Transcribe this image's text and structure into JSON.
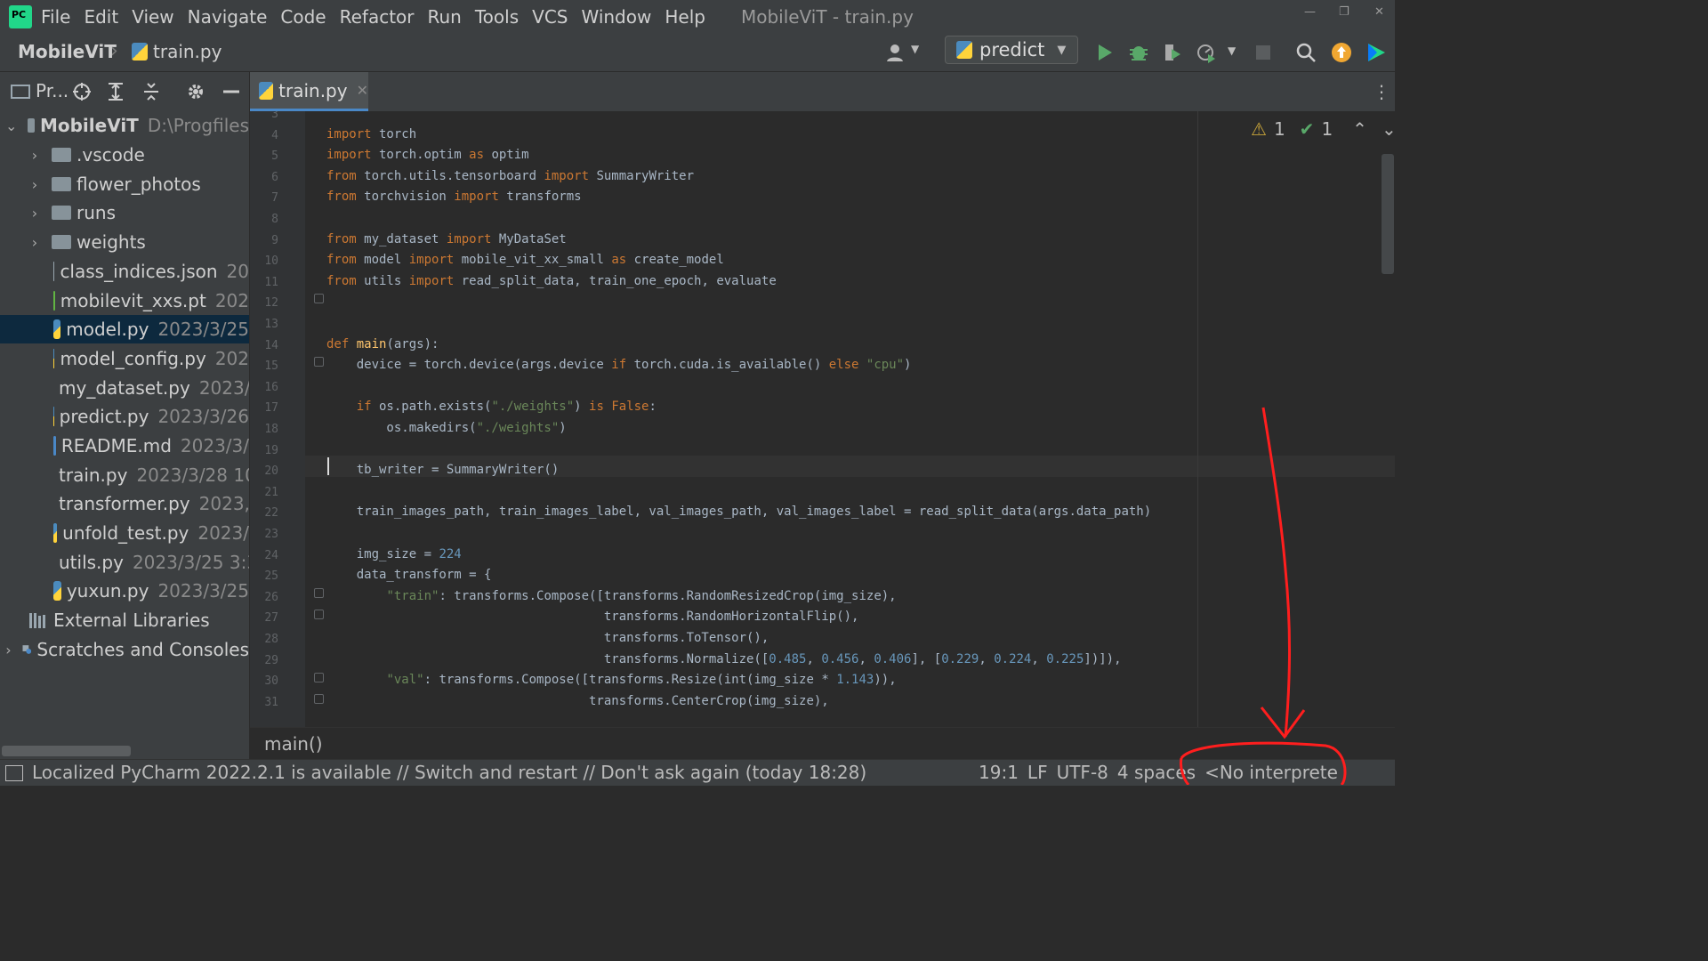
{
  "menubar": {
    "items": [
      "File",
      "Edit",
      "View",
      "Navigate",
      "Code",
      "Refactor",
      "Run",
      "Tools",
      "VCS",
      "Window",
      "Help"
    ],
    "window_title": "MobileViT - train.py"
  },
  "navbar": {
    "project": "MobileViT",
    "file": "train.py",
    "run_config": "predict"
  },
  "project_toolbar": {
    "label": "Pr..."
  },
  "project_tree": [
    {
      "name": "MobileViT",
      "detail": "D:\\Progfiles",
      "kind": "root"
    },
    {
      "name": ".vscode",
      "kind": "folder"
    },
    {
      "name": "flower_photos",
      "kind": "folder"
    },
    {
      "name": "runs",
      "kind": "folder"
    },
    {
      "name": "weights",
      "kind": "folder"
    },
    {
      "name": "class_indices.json",
      "detail": "20",
      "kind": "json"
    },
    {
      "name": "mobilevit_xxs.pt",
      "detail": "202",
      "kind": "pt"
    },
    {
      "name": "model.py",
      "detail": "2023/3/25",
      "kind": "py",
      "selected": true
    },
    {
      "name": "model_config.py",
      "detail": "202",
      "kind": "py"
    },
    {
      "name": "my_dataset.py",
      "detail": "2023/",
      "kind": "py"
    },
    {
      "name": "predict.py",
      "detail": "2023/3/26",
      "kind": "py"
    },
    {
      "name": "README.md",
      "detail": "2023/3/",
      "kind": "md"
    },
    {
      "name": "train.py",
      "detail": "2023/3/28 10",
      "kind": "py"
    },
    {
      "name": "transformer.py",
      "detail": "2023,",
      "kind": "py"
    },
    {
      "name": "unfold_test.py",
      "detail": "2023/",
      "kind": "py"
    },
    {
      "name": "utils.py",
      "detail": "2023/3/25 3:3",
      "kind": "py"
    },
    {
      "name": "yuxun.py",
      "detail": "2023/3/25",
      "kind": "py"
    },
    {
      "name": "External Libraries",
      "kind": "lib"
    },
    {
      "name": "Scratches and Consoles",
      "kind": "scratch"
    }
  ],
  "editor": {
    "tab": "train.py",
    "inspections": {
      "warnings": "1",
      "ok": "1"
    },
    "lines": [
      {
        "n": "3",
        "html": ""
      },
      {
        "n": "4",
        "html": "<span class='k'>import</span> torch"
      },
      {
        "n": "5",
        "html": "<span class='k'>import</span> torch.optim <span class='k'>as</span> optim"
      },
      {
        "n": "6",
        "html": "<span class='k'>from</span> torch.utils.tensorboard <span class='k'>import</span> SummaryWriter"
      },
      {
        "n": "7",
        "html": "<span class='k'>from</span> torchvision <span class='k'>import</span> transforms"
      },
      {
        "n": "8",
        "html": ""
      },
      {
        "n": "9",
        "html": "<span class='k'>from</span> my_dataset <span class='k'>import</span> MyDataSet"
      },
      {
        "n": "10",
        "html": "<span class='k'>from</span> model <span class='k'>import</span> mobile_vit_xx_small <span class='k'>as</span> create_model"
      },
      {
        "n": "11",
        "html": "<span class='k'>from</span> utils <span class='k'>import</span> read_split_data, train_one_epoch, evaluate"
      },
      {
        "n": "12",
        "html": ""
      },
      {
        "n": "13",
        "html": ""
      },
      {
        "n": "14",
        "html": "<span class='k'>def</span> <span class='f'>main</span>(args):"
      },
      {
        "n": "15",
        "html": "    device = torch.device(args.device <span class='k'>if</span> torch.cuda.is_available() <span class='k'>else</span> <span class='s'>\"cpu\"</span>)"
      },
      {
        "n": "16",
        "html": ""
      },
      {
        "n": "17",
        "html": "    <span class='k'>if</span> os.path.exists(<span class='s'>\"./weights\"</span>) <span class='k'>is</span> <span class='k'>False</span>:"
      },
      {
        "n": "18",
        "html": "        os.makedirs(<span class='s'>\"./weights\"</span>)"
      },
      {
        "n": "19",
        "html": ""
      },
      {
        "n": "20",
        "html": "    tb_writer = SummaryWriter()"
      },
      {
        "n": "21",
        "html": ""
      },
      {
        "n": "22",
        "html": "    train_images_path, train_images_label, val_images_path, val_images_label = read_split_data(args.data_path)"
      },
      {
        "n": "23",
        "html": ""
      },
      {
        "n": "24",
        "html": "    img_size = <span class='n'>224</span>"
      },
      {
        "n": "25",
        "html": "    data_transform = {"
      },
      {
        "n": "26",
        "html": "        <span class='s'>\"train\"</span>: transforms.Compose([transforms.RandomResizedCrop(img_size),"
      },
      {
        "n": "27",
        "html": "                                     transforms.RandomHorizontalFlip(),"
      },
      {
        "n": "28",
        "html": "                                     transforms.ToTensor(),"
      },
      {
        "n": "29",
        "html": "                                     transforms.Normalize([<span class='n'>0.485</span>, <span class='n'>0.456</span>, <span class='n'>0.406</span>], [<span class='n'>0.229</span>, <span class='n'>0.224</span>, <span class='n'>0.225</span>])]),"
      },
      {
        "n": "30",
        "html": "        <span class='s'>\"val\"</span>: transforms.Compose([transforms.Resize(int(img_size * <span class='n'>1.143</span>)),"
      },
      {
        "n": "31",
        "html": "                                   transforms.CenterCrop(img_size),"
      }
    ],
    "breadcrumb": "main()"
  },
  "statusbar": {
    "message": "Localized PyCharm 2022.2.1 is available // Switch and restart // Don't ask again (today 18:28)",
    "position": "19:1",
    "line_sep": "LF",
    "encoding": "UTF-8",
    "indent": "4 spaces",
    "interpreter": "<No interprete"
  },
  "colors": {
    "annotation": "#ff1e1e",
    "keyword": "#cc7832",
    "string": "#6a8759",
    "number": "#6897bb"
  }
}
